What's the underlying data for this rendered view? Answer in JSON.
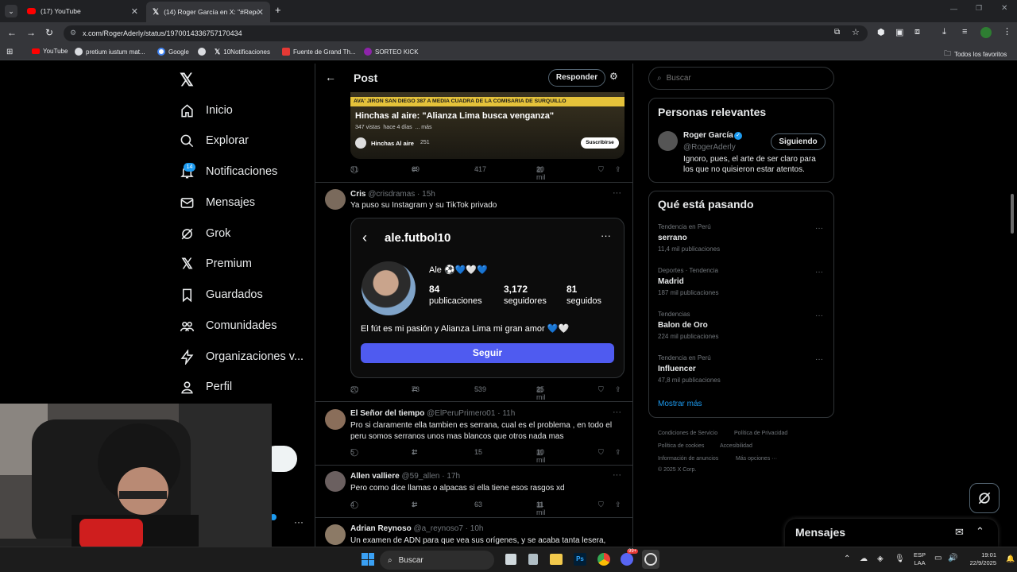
{
  "browser": {
    "tabs": [
      {
        "title": "(17) YouTube"
      },
      {
        "title": "(14) Roger García en X: \"#Repor"
      }
    ],
    "url": "x.com/RogerAderly/status/1970014336757170434",
    "bookmarks": [
      "YouTube",
      "pretium iustum mat...",
      "Google",
      "",
      "10Notificaciones",
      "Fuente de Grand Th...",
      "SORTEO KICK"
    ],
    "all_bookmarks": "Todos los favoritos"
  },
  "nav": {
    "items": [
      "Inicio",
      "Explorar",
      "Notificaciones",
      "Mensajes",
      "Grok",
      "Premium",
      "Guardados",
      "Comunidades",
      "Organizaciones v...",
      "Perfil"
    ],
    "notif_badge": "14"
  },
  "header": {
    "title": "Post",
    "reply_button": "Responder"
  },
  "embedded_video": {
    "banner": "AVA' JIRON SAN DIEGO 387 A MEDIA CUADRA DE LA COMISARIA DE SURQUILLO",
    "title": "Hinchas al aire: \"Alianza Lima busca venganza\"",
    "meta": "347 vistas  hace 4 días  ... más",
    "channel": "Hinchas Al aire",
    "channel_count": "251",
    "subscribe": "Suscribirse"
  },
  "main_post_stats": {
    "replies": "31",
    "reposts": "69",
    "likes": "417",
    "views": "20 mil"
  },
  "replies": [
    {
      "name": "Cris",
      "handle": "@crisdramas · 15h",
      "text": "Ya puso su Instagram y su TikTok privado",
      "stats": {
        "replies": "20",
        "reposts": "73",
        "likes": "539",
        "views": "25 mil"
      }
    },
    {
      "name": "El Señor del tiempo",
      "handle": "@ElPeruPrimero01 · 11h",
      "text": "Pro si claramente ella tambien es serrana, cual es el problema , en todo el peru somos serranos unos mas blancos que otros nada mas",
      "stats": {
        "replies": "5",
        "reposts": "1",
        "likes": "15",
        "views": "10 mil"
      }
    },
    {
      "name": "Allen valliere",
      "handle": "@59_allen · 17h",
      "text": "Pero como dice llamas o alpacas si ella tiene esos rasgos xd",
      "stats": {
        "replies": "4",
        "reposts": "1",
        "likes": "63",
        "views": "11 mil"
      }
    },
    {
      "name": "Adrian Reynoso",
      "handle": "@a_reynoso7 · 10h",
      "text": "Un examen de ADN para que vea sus orígenes, y se acaba tanta lesera,"
    }
  ],
  "instagram": {
    "username": "ale.futbol10",
    "display_name": "Ale ⚽💙🤍💙",
    "posts": "84",
    "posts_label": "publicaciones",
    "followers": "3,172",
    "followers_label": "seguidores",
    "following": "81",
    "following_label": "seguidos",
    "bio": "El fút es mi pasión y Alianza Lima mi gran amor 💙🤍",
    "follow_button": "Seguir"
  },
  "search": {
    "placeholder": "Buscar"
  },
  "relevant": {
    "title": "Personas relevantes",
    "name": "Roger García",
    "handle": "@RogerAderly",
    "button": "Siguiendo",
    "bio": "Ignoro, pues, el arte de ser claro para los que no quisieron estar atentos."
  },
  "trending": {
    "title": "Qué está pasando",
    "items": [
      {
        "meta": "Tendencia en Perú",
        "name": "serrano",
        "count": "11,4 mil publicaciones"
      },
      {
        "meta": "Deportes · Tendencia",
        "name": "Madrid",
        "count": "187 mil publicaciones"
      },
      {
        "meta": "Tendencias",
        "name": "Balon de Oro",
        "count": "224 mil publicaciones"
      },
      {
        "meta": "Tendencia en Perú",
        "name": "Influencer",
        "count": "47,8 mil publicaciones"
      }
    ],
    "show_more": "Mostrar más"
  },
  "footer": [
    "Condiciones de Servicio",
    "Política de Privacidad",
    "Política de cookies",
    "Accesibilidad",
    "Información de anuncios",
    "Más opciones ···",
    "© 2025 X Corp."
  ],
  "messages_bar": {
    "title": "Mensajes"
  },
  "taskbar": {
    "search": "Buscar",
    "lang1": "ESP",
    "lang2": "LAA",
    "time": "19:01",
    "date": "22/9/2025",
    "badge": "99+"
  }
}
